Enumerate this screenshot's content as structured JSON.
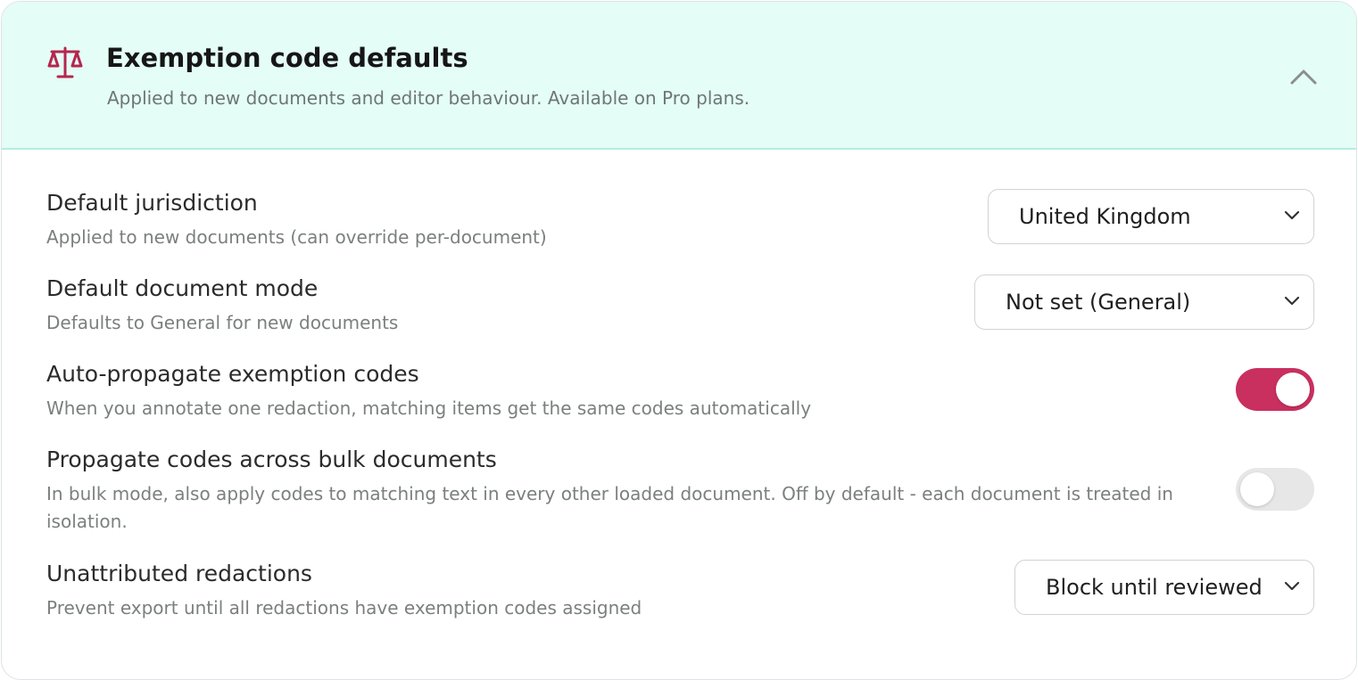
{
  "header": {
    "icon": "scales-icon",
    "title": "Exemption code defaults",
    "subtitle": "Applied to new documents and editor behaviour. Available on Pro plans.",
    "collapse_icon": "chevron-up-icon"
  },
  "colors": {
    "accent": "#c9305f",
    "header_bg": "#e4fdf6",
    "header_border": "#b6ece0"
  },
  "settings": {
    "jurisdiction": {
      "label": "Default jurisdiction",
      "description": "Applied to new documents (can override per-document)",
      "value": "United Kingdom"
    },
    "document_mode": {
      "label": "Default document mode",
      "description": "Defaults to General for new documents",
      "value": "Not set (General)"
    },
    "auto_propagate": {
      "label": "Auto-propagate exemption codes",
      "description": "When you annotate one redaction, matching items get the same codes automatically",
      "enabled": true
    },
    "bulk_propagate": {
      "label": "Propagate codes across bulk documents",
      "description": "In bulk mode, also apply codes to matching text in every other loaded document. Off by default - each document is treated in isolation.",
      "enabled": false
    },
    "unattributed": {
      "label": "Unattributed redactions",
      "description": "Prevent export until all redactions have exemption codes assigned",
      "value": "Block until reviewed"
    }
  }
}
